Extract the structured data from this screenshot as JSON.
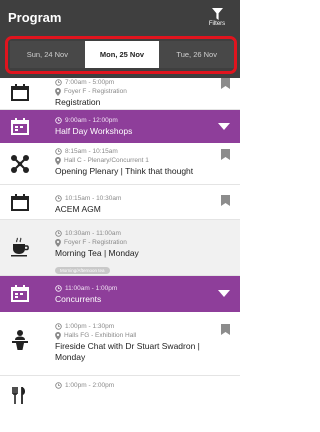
{
  "header": {
    "title": "Program",
    "filters_label": "Filters"
  },
  "tabs": [
    {
      "label": "Sun, 24 Nov"
    },
    {
      "label": "Mon, 25 Nov"
    },
    {
      "label": "Tue, 26 Nov"
    }
  ],
  "items": [
    {
      "time": "7:00am - 5:00pm",
      "location": "Foyer F - Registration",
      "title": "Registration"
    },
    {
      "time": "9:00am - 12:00pm",
      "title": "Half Day Workshops"
    },
    {
      "time": "8:15am - 10:15am",
      "location": "Hall C - Plenary/Concurrent 1",
      "title": "Opening Plenary | Think that thought"
    },
    {
      "time": "10:15am - 10:30am",
      "title": "ACEM AGM"
    },
    {
      "time": "10:30am - 11:00am",
      "location": "Foyer F - Registration",
      "title": "Morning Tea | Monday",
      "tag": "Morning/Afternoon tea"
    },
    {
      "time": "11:00am - 1:00pm",
      "title": "Concurrents"
    },
    {
      "time": "1:00pm - 1:30pm",
      "location": "Halls FG - Exhibition Hall",
      "title": "Fireside Chat with Dr Stuart Swadron | Monday"
    },
    {
      "time": "1:00pm - 2:00pm"
    }
  ],
  "colors": {
    "header": "#3f3f3f",
    "session": "#8e3e9a",
    "highlight": "#e0141e"
  },
  "icons": [
    "filter-icon",
    "calendar-icon",
    "calendar-group-icon",
    "plenary-icon",
    "tea-cup-icon",
    "speaker-icon",
    "lunch-icon",
    "clock-icon",
    "location-pin-icon",
    "bookmark-icon",
    "chevron-down-icon"
  ]
}
